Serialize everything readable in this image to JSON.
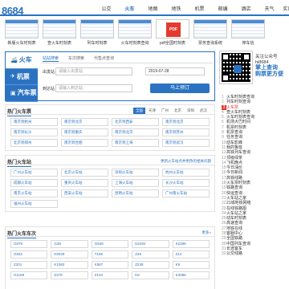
{
  "logo": "8684",
  "nav": [
    "公交",
    "火车",
    "地图",
    "地铁",
    "机票",
    "邮编",
    "酒店",
    "天气",
    "实用工具"
  ],
  "nav_active": 1,
  "thumbs": [
    {
      "caption": "新版火车时刻表"
    },
    {
      "caption": "查火车时刻表"
    },
    {
      "caption": "列车时刻表"
    },
    {
      "caption": "火车时刻表查询"
    },
    {
      "caption": "pdf全国时刻表",
      "pdf": "PDF"
    },
    {
      "caption": "票务查询系统"
    },
    {
      "caption": "停车信"
    }
  ],
  "side_tabs": [
    {
      "label": "火车",
      "icon": "train-icon",
      "glyph": "🚄"
    },
    {
      "label": "机票",
      "icon": "plane-icon",
      "glyph": "✈"
    },
    {
      "label": "汽车票",
      "icon": "bus-icon",
      "glyph": "▣"
    }
  ],
  "search": {
    "modes": [
      "站站搜索",
      "车次搜索",
      "代售点查询"
    ],
    "from_label": "出发站",
    "from_placeholder": "请输入出发站",
    "date_value": "2019-07-28",
    "to_label": "到达站",
    "to_placeholder": "请输入到达站",
    "submit": "马上预订"
  },
  "qr": {
    "line1": "关注公众号",
    "line2": "hi8684",
    "line3": "掌上查询",
    "line4": "购票更方便"
  },
  "right_list": [
    "火车时刻表查询",
    "列车时刻查询",
    "火车票",
    "查火车时刻表",
    "火车时刻表查询",
    "机场大巴时间",
    "机票时刻表",
    "机票查询",
    "任务查询",
    "动车影峰",
    "我的鲁班",
    "高铁列车查询",
    "顶级绿茶",
    "飞机晚点",
    "今日油价",
    "今日新闻",
    "高铁线路",
    "火车票时刻表",
    "铁路查询",
    "快运查询",
    "火车站之家",
    "21城地铁网络",
    "在线铁路图",
    "火车站之家",
    "动车时刻表",
    "高速查询",
    "地铁在线",
    "客服中心",
    "全国铁路",
    "中国列车查询",
    "长途客车",
    "公交线路"
  ],
  "right_list_highlight": 2,
  "hot_tickets": {
    "title": "热门火车票",
    "cities": [
      "全国",
      "天津",
      "广州",
      "北京",
      "深圳",
      "武汉"
    ],
    "active_city": 0,
    "items": [
      "南京到杭州",
      "南京到北京",
      "北京到西安",
      "南京到北京",
      "南京到长沙",
      "南京到重庆",
      "南京到北京",
      "南京到苏州",
      "北京到郑州",
      "南京到合肥",
      "南京到上海",
      "南京到武汉"
    ]
  },
  "hot_stations": {
    "title": "热门火车站",
    "more": "更新火车站点并更改的相关问题",
    "items": [
      "广州火车站",
      "北京火车站",
      "深圳火车站",
      "杭州火车站",
      "成都火车站",
      "重庆火车站",
      "上海火车站",
      "长沙火车站",
      "南京火车站",
      "西安火车站",
      "昆明火车站",
      "广州南火车站",
      "福州火车站"
    ]
  },
  "hot_trains": {
    "title": "热门火车车次",
    "more": "更多»",
    "items": [
      "G879",
      "G38",
      "G528",
      "D2202",
      "K2286",
      "G832",
      "K8029",
      "T168",
      "Z49",
      "Z14",
      "Z201",
      "K1082",
      "K587",
      "Z238",
      "K5",
      "G1159",
      "Z378",
      "Z134",
      "K8",
      "K2086"
    ]
  }
}
